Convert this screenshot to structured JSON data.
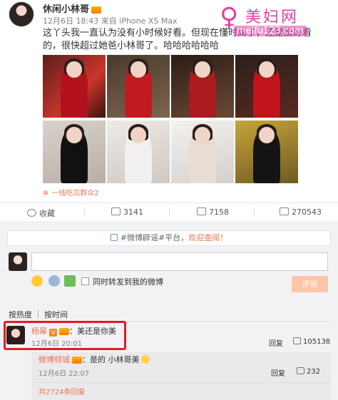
{
  "post": {
    "username": "休闲小林哥",
    "meta": "12月6日 18:43 来自 iPhone XS Max",
    "text": "这丫头我一直认为没有小时候好看。但现在懂时尚了，还是挺好看的，很快超过她爸小林哥了。哈哈哈哈哈哈",
    "group_link": "一线吃瓜群众2"
  },
  "watermark": {
    "glyph": "♀",
    "name": "美妇网",
    "url": "meifu123.com"
  },
  "actions": {
    "favorite_label": "收藏",
    "repost_count": "3141",
    "comment_count": "7158",
    "like_count": "270543"
  },
  "comment_area": {
    "notice_prefix": "#微博辟谣#平台，",
    "notice_link": "欢迎查阅！",
    "repost_checkbox_label": "同时转发到我的微博",
    "submit_label": "评论",
    "sort_hot": "按热度",
    "sort_time": "按时间"
  },
  "comments": [
    {
      "name": "杨幂",
      "text": "：美还是你美",
      "time": "12月6日 20:01",
      "reply": "回复",
      "likes": "105138"
    }
  ],
  "replies": [
    {
      "name": "微博倾城",
      "text": "：是的 小林哥美",
      "time": "12月6日 22:07",
      "reply": "回复",
      "likes": "232"
    }
  ],
  "more_replies": "共2724条回复",
  "colors": {
    "accent": "#eb7350",
    "highlight_box": "#e21d1d",
    "watermark": "#e23ea6",
    "panel": "#f2f2f5"
  }
}
